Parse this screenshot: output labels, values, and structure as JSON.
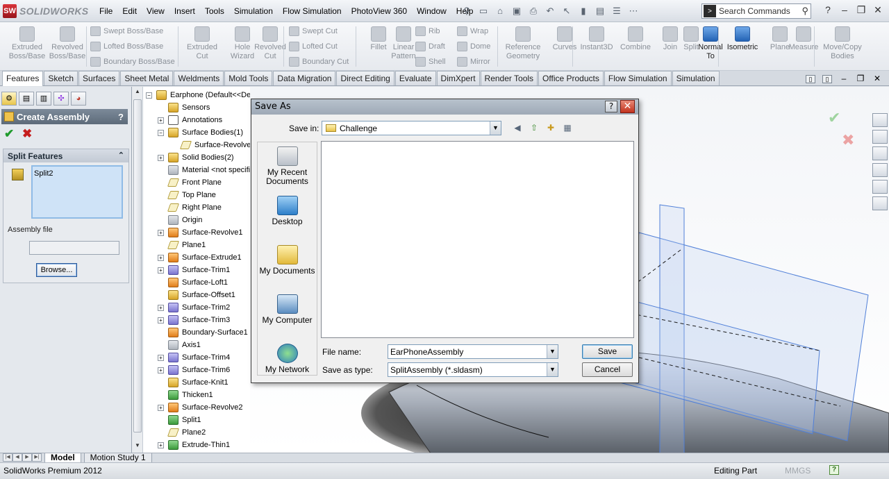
{
  "app": {
    "brand": "SOLIDWORKS",
    "menus": [
      "File",
      "Edit",
      "View",
      "Insert",
      "Tools",
      "Simulation",
      "Flow Simulation",
      "PhotoView 360",
      "Window",
      "Help"
    ],
    "search_placeholder": "Search Commands"
  },
  "ribbon": {
    "big": [
      {
        "label": "Extruded Boss/Base",
        "lines": [
          "Extruded",
          "Boss/Base"
        ]
      },
      {
        "label": "Revolved Boss/Base",
        "lines": [
          "Revolved",
          "Boss/Base"
        ]
      },
      {
        "label": "Extruded Cut",
        "lines": [
          "Extruded",
          "Cut"
        ]
      },
      {
        "label": "Hole Wizard",
        "lines": [
          "Hole",
          "Wizard"
        ]
      },
      {
        "label": "Revolved Cut",
        "lines": [
          "Revolved",
          "Cut"
        ]
      },
      {
        "label": "Fillet",
        "lines": [
          "Fillet"
        ]
      },
      {
        "label": "Linear Pattern",
        "lines": [
          "Linear",
          "Pattern"
        ]
      },
      {
        "label": "Reference Geometry",
        "lines": [
          "Reference",
          "Geometry"
        ]
      },
      {
        "label": "Curves",
        "lines": [
          "Curves"
        ]
      },
      {
        "label": "Instant3D",
        "lines": [
          "Instant3D"
        ]
      },
      {
        "label": "Combine",
        "lines": [
          "Combine"
        ]
      },
      {
        "label": "Join",
        "lines": [
          "Join"
        ]
      },
      {
        "label": "Split",
        "lines": [
          "Split"
        ]
      },
      {
        "label": "Normal To",
        "lines": [
          "Normal",
          "To"
        ]
      },
      {
        "label": "Isometric",
        "lines": [
          "Isometric"
        ]
      },
      {
        "label": "Plane",
        "lines": [
          "Plane"
        ]
      },
      {
        "label": "Measure",
        "lines": [
          "Measure"
        ]
      },
      {
        "label": "Move/Copy Bodies",
        "lines": [
          "Move/Copy",
          "Bodies"
        ]
      }
    ],
    "small": {
      "swept_boss": "Swept Boss/Base",
      "lofted_boss": "Lofted Boss/Base",
      "boundary_boss": "Boundary Boss/Base",
      "swept_cut": "Swept Cut",
      "lofted_cut": "Lofted Cut",
      "boundary_cut": "Boundary Cut",
      "rib": "Rib",
      "draft": "Draft",
      "shell": "Shell",
      "wrap": "Wrap",
      "dome": "Dome",
      "mirror": "Mirror"
    }
  },
  "tabs": [
    "Features",
    "Sketch",
    "Surfaces",
    "Sheet Metal",
    "Weldments",
    "Mold Tools",
    "Data Migration",
    "Direct Editing",
    "Evaluate",
    "DimXpert",
    "Render Tools",
    "Office Products",
    "Flow Simulation",
    "Simulation"
  ],
  "property_manager": {
    "title": "Create Assembly",
    "help": "?",
    "group_title": "Split Features",
    "split_items": [
      "Split2"
    ],
    "assembly_file_label": "Assembly file",
    "assembly_file_value": "",
    "browse_label": "Browse..."
  },
  "tree": {
    "root": "Earphone  (Default<<Def",
    "items": [
      {
        "label": "Sensors",
        "expand": false,
        "icon": "yellow"
      },
      {
        "label": "Annotations",
        "expand": true,
        "icon": "text"
      },
      {
        "label": "Surface Bodies(1)",
        "expand": true,
        "icon": "yellow",
        "open": true
      },
      {
        "label": "Surface-Revolve",
        "expand": false,
        "icon": "plane",
        "indent": 1
      },
      {
        "label": "Solid Bodies(2)",
        "expand": true,
        "icon": "yellow"
      },
      {
        "label": "Material <not specifie",
        "expand": false,
        "icon": "gray"
      },
      {
        "label": "Front Plane",
        "expand": false,
        "icon": "plane"
      },
      {
        "label": "Top Plane",
        "expand": false,
        "icon": "plane"
      },
      {
        "label": "Right Plane",
        "expand": false,
        "icon": "plane"
      },
      {
        "label": "Origin",
        "expand": false,
        "icon": "gray"
      },
      {
        "label": "Surface-Revolve1",
        "expand": true,
        "icon": "orange"
      },
      {
        "label": "Plane1",
        "expand": false,
        "icon": "plane"
      },
      {
        "label": "Surface-Extrude1",
        "expand": true,
        "icon": "orange"
      },
      {
        "label": "Surface-Trim1",
        "expand": true,
        "icon": "purple"
      },
      {
        "label": "Surface-Loft1",
        "expand": false,
        "icon": "orange"
      },
      {
        "label": "Surface-Offset1",
        "expand": false,
        "icon": "yellow"
      },
      {
        "label": "Surface-Trim2",
        "expand": true,
        "icon": "purple"
      },
      {
        "label": "Surface-Trim3",
        "expand": true,
        "icon": "purple"
      },
      {
        "label": "Boundary-Surface1",
        "expand": false,
        "icon": "orange"
      },
      {
        "label": "Axis1",
        "expand": false,
        "icon": "gray"
      },
      {
        "label": "Surface-Trim4",
        "expand": true,
        "icon": "purple"
      },
      {
        "label": "Surface-Trim6",
        "expand": true,
        "icon": "purple"
      },
      {
        "label": "Surface-Knit1",
        "expand": false,
        "icon": "yellow"
      },
      {
        "label": "Thicken1",
        "expand": false,
        "icon": "green"
      },
      {
        "label": "Surface-Revolve2",
        "expand": true,
        "icon": "orange"
      },
      {
        "label": "Split1",
        "expand": false,
        "icon": "green"
      },
      {
        "label": "Plane2",
        "expand": false,
        "icon": "plane"
      },
      {
        "label": "Extrude-Thin1",
        "expand": true,
        "icon": "green"
      }
    ]
  },
  "dialog": {
    "title": "Save As",
    "save_in_label": "Save in:",
    "save_in_value": "Challenge",
    "places": [
      "My Recent Documents",
      "Desktop",
      "My Documents",
      "My Computer",
      "My Network"
    ],
    "file_name_label": "File name:",
    "file_name_value": "EarPhoneAssembly",
    "save_type_label": "Save as type:",
    "save_type_value": "SplitAssembly (*.sldasm)",
    "save_button": "Save",
    "cancel_button": "Cancel"
  },
  "doc_tabs": [
    "Model",
    "Motion Study 1"
  ],
  "status": {
    "product": "SolidWorks Premium 2012",
    "mode": "Editing Part",
    "units": "MMGS",
    "help": "?"
  }
}
